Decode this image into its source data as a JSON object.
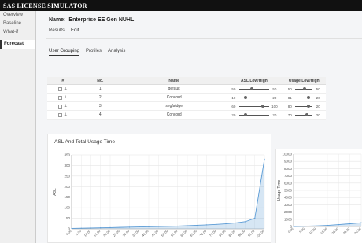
{
  "app": {
    "title": "SAS LICENSE SIMULATOR"
  },
  "sidebar": {
    "items": [
      {
        "label": "Overview"
      },
      {
        "label": "Baseline"
      },
      {
        "label": "What-if"
      },
      {
        "label": "Forecast"
      }
    ]
  },
  "header": {
    "name_label": "Name:",
    "name_value": "Enterprise EE Gen NUHL"
  },
  "top_tabs": [
    "Results",
    "Edit"
  ],
  "sub_tabs": [
    "User Grouping",
    "Profiles",
    "Analysis"
  ],
  "table": {
    "headers": [
      "#",
      "No.",
      "Name",
      "ASL Low/High",
      "Usage Low/High"
    ],
    "rows": [
      {
        "no": "1",
        "name": "default",
        "asl_low": "50",
        "asl_high": "50",
        "usage_low": "50",
        "usage_high": "50"
      },
      {
        "no": "2",
        "name": "Concord",
        "asl_low": "10",
        "asl_high": "20",
        "usage_low": "81",
        "usage_high": "20"
      },
      {
        "no": "3",
        "name": "segfaidge",
        "asl_low": "60",
        "asl_high": "100",
        "usage_low": "80",
        "usage_high": "20"
      },
      {
        "no": "4",
        "name": "Concord",
        "asl_low": "20",
        "asl_high": "20",
        "usage_low": "70",
        "usage_high": "20"
      }
    ]
  },
  "colors": {
    "line": "#5b9bd5",
    "grid": "#e6e6e6",
    "titlebar": "#111111"
  },
  "chart_data": [
    {
      "type": "area",
      "title": "ASL And Total Usage Time",
      "ylabel": "ASL",
      "ylim": [
        0,
        350
      ],
      "yticks": [
        "0",
        "50",
        "100",
        "150",
        "200",
        "250",
        "300",
        "350"
      ],
      "x": [
        "0.00",
        "5.00",
        "10.00",
        "15.00",
        "20.00",
        "25.00",
        "30.00",
        "35.00",
        "40.00",
        "45.00",
        "50.00",
        "55.00",
        "60.00",
        "65.00",
        "70.00",
        "75.00",
        "80.00",
        "85.00",
        "90.00",
        "95.00",
        "100.00"
      ],
      "values": [
        2,
        3,
        4,
        5,
        6,
        7,
        8,
        9,
        10,
        11,
        12,
        13,
        15,
        17,
        19,
        21,
        24,
        28,
        34,
        50,
        330
      ]
    },
    {
      "type": "area",
      "title": "",
      "ylabel": "Usage Time",
      "ylim": [
        0,
        10000
      ],
      "yticks": [
        "0",
        "1000",
        "2000",
        "3000",
        "4000",
        "5000",
        "6000",
        "7000",
        "8000",
        "9000",
        "10000"
      ],
      "x": [
        "0.00",
        "5.00",
        "10.00",
        "15.00",
        "20.00",
        "25.00",
        "30.00"
      ],
      "values": [
        0,
        40,
        90,
        160,
        260,
        380,
        520
      ]
    }
  ]
}
